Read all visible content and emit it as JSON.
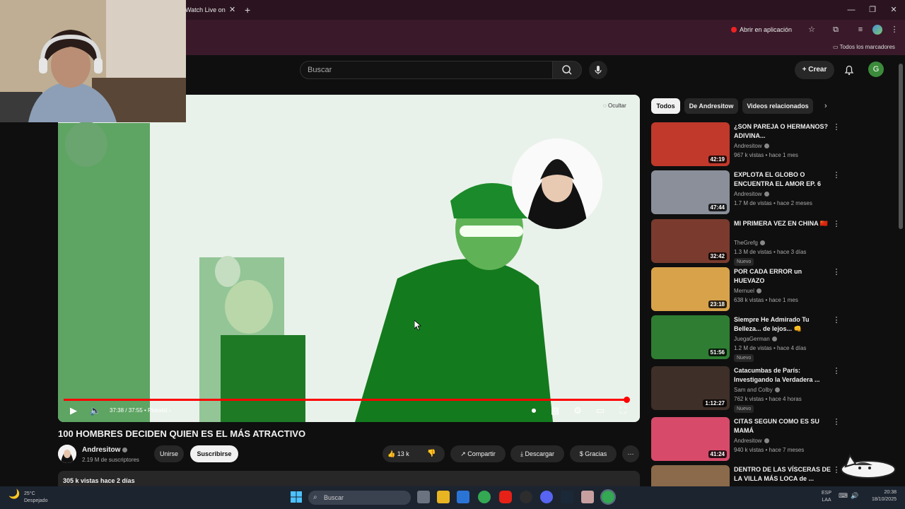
{
  "browser": {
    "tab_title": "Watch Live on",
    "tab_close": "✕",
    "new_tab": "+",
    "window_controls": [
      "—",
      "❐",
      "✕"
    ],
    "open_in_app": "Abrir en aplicación",
    "bookmarks_all": "Todos los marcadores"
  },
  "header": {
    "search_placeholder": "Buscar",
    "create_label": "Crear",
    "avatar_letter": "G"
  },
  "player": {
    "hide_label": "Ocultar",
    "time": "37:38 / 37:55",
    "chapter": "• Plotwist",
    "progress_fraction": 0.994
  },
  "video": {
    "title": "100 HOMBRES DECIDEN QUIEN ES EL MÁS ATRACTIVO",
    "channel": "Andresitow",
    "subscribers": "2.19 M de suscriptores",
    "join_label": "Unirse",
    "subscribe_label": "Suscribirse",
    "likes": "13 k",
    "share_label": "Compartir",
    "download_label": "Descargar",
    "thanks_label": "Gracias",
    "views_line": "305 k vistas  hace 2 días"
  },
  "chips": [
    "Todos",
    "De Andresitow",
    "Videos relacionados"
  ],
  "recommendations": [
    {
      "title": "¿SON PAREJA O HERMANOS? ADIVINA...",
      "channel": "Andresitow",
      "meta": "967 k vistas • hace 1 mes",
      "duration": "42:19",
      "badge": "",
      "color": "#c0392b"
    },
    {
      "title": "EXPLOTA EL GLOBO O ENCUENTRA EL AMOR EP. 6",
      "channel": "Andresitow",
      "meta": "1.7 M de vistas • hace 2 meses",
      "duration": "47:44",
      "badge": "",
      "color": "#8a8f99"
    },
    {
      "title": "MI PRIMERA VEZ EN CHINA 🇨🇳",
      "channel": "TheGrefg",
      "meta": "1.3 M de vistas • hace 3 días",
      "duration": "32:42",
      "badge": "Nuevo",
      "color": "#7a3b2e"
    },
    {
      "title": "POR CADA ERROR un HUEVAZO",
      "channel": "Mernuel",
      "meta": "638 k vistas • hace 1 mes",
      "duration": "23:18",
      "badge": "",
      "color": "#d8a24a"
    },
    {
      "title": "Siempre He Admirado Tu Belleza... de lejos... 👊",
      "channel": "JuegaGerman",
      "meta": "1.2 M de vistas • hace 4 días",
      "duration": "51:56",
      "badge": "Nuevo",
      "color": "#2e7d32"
    },
    {
      "title": "Catacumbas de París: Investigando la Verdadera ...",
      "channel": "Sam and Colby",
      "meta": "762 k vistas • hace 4 horas",
      "duration": "1:12:27",
      "badge": "Nuevo",
      "color": "#3e2f28"
    },
    {
      "title": "CITAS SEGUN COMO ES SU MAMÁ",
      "channel": "Andresitow",
      "meta": "940 k vistas • hace 7 meses",
      "duration": "41:24",
      "badge": "",
      "color": "#d84a6a"
    },
    {
      "title": "DENTRO DE LAS VÍSCERAS DE LA VILLA MÁS LOCA de ...",
      "channel": "",
      "meta": "",
      "duration": "",
      "badge": "",
      "color": "#8a6a4a"
    }
  ],
  "taskbar": {
    "weather_temp": "25°C",
    "weather_desc": "Despejado",
    "search_placeholder": "Buscar",
    "lang_top": "ESP",
    "lang_bottom": "LAA",
    "time": "20:38",
    "date": "18/10/2025"
  }
}
